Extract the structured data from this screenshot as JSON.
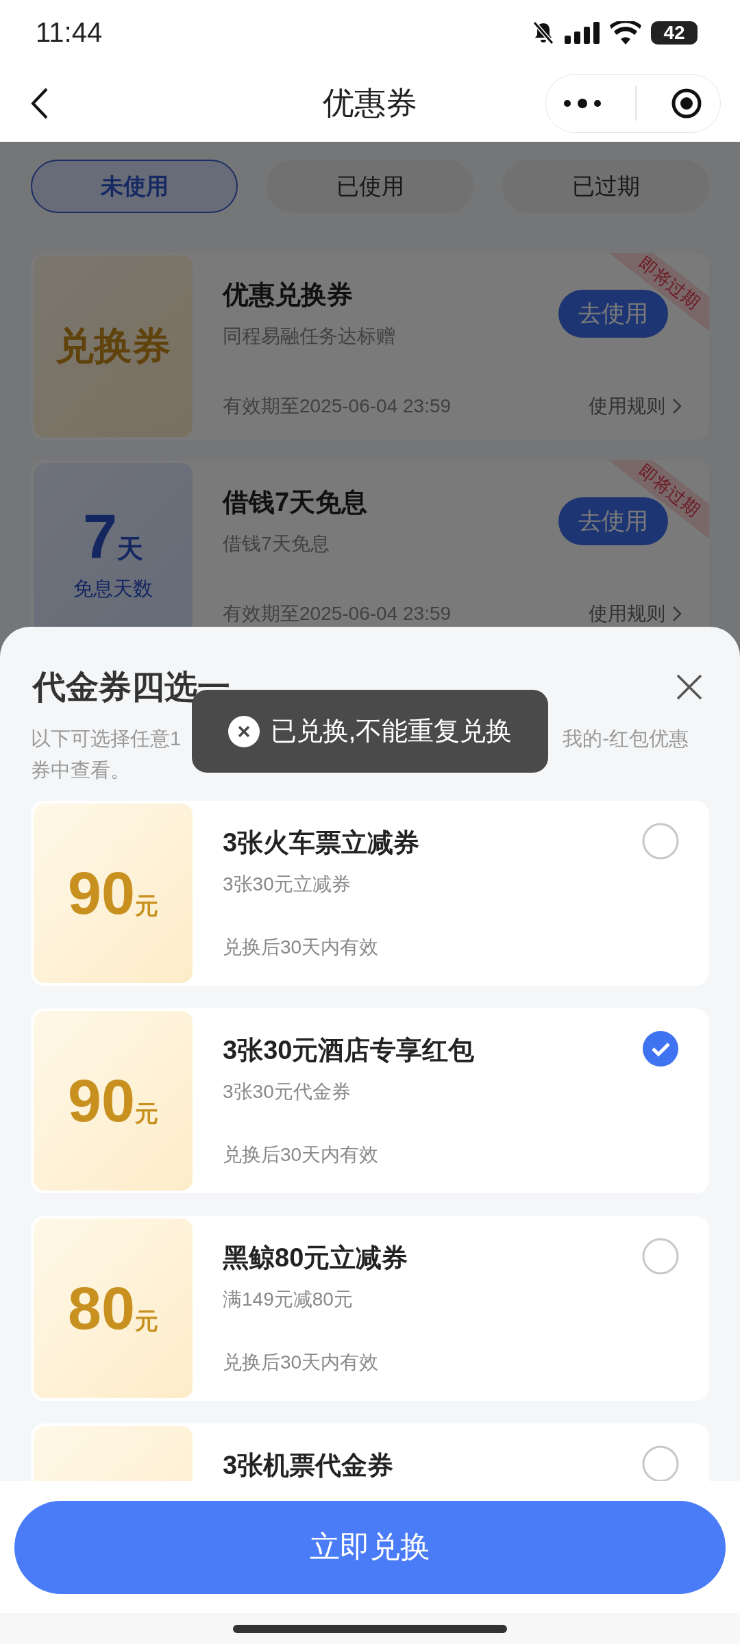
{
  "status_bar": {
    "time": "11:44",
    "battery": "42"
  },
  "nav": {
    "title": "优惠券"
  },
  "tabs": [
    {
      "label": "未使用",
      "selected": true
    },
    {
      "label": "已使用",
      "selected": false
    },
    {
      "label": "已过期",
      "selected": false
    }
  ],
  "coupons": [
    {
      "left": {
        "kind": "label",
        "text": "兑换券"
      },
      "title": "优惠兑换券",
      "subtitle": "同程易融任务达标赠",
      "validity": "有效期至2025-06-04 23:59",
      "action": "去使用",
      "rules": "使用规则",
      "ribbon": "即将过期"
    },
    {
      "left": {
        "kind": "days",
        "value": "7",
        "unit": "天",
        "caption": "免息天数"
      },
      "title": "借钱7天免息",
      "subtitle": "借钱7天免息",
      "validity": "有效期至2025-06-04 23:59",
      "action": "去使用",
      "rules": "使用规则",
      "ribbon": "即将过期"
    }
  ],
  "sheet": {
    "title": "代金券四选一",
    "description": [
      [
        "以下可选择任意1",
        "我的-红包优惠"
      ],
      [
        "券中查看。"
      ]
    ],
    "options": [
      {
        "amount": "90",
        "unit": "元",
        "title": "3张火车票立减券",
        "subtitle": "3张30元立减券",
        "validity": "兑换后30天内有效",
        "selected": false
      },
      {
        "amount": "90",
        "unit": "元",
        "title": "3张30元酒店专享红包",
        "subtitle": "3张30元代金券",
        "validity": "兑换后30天内有效",
        "selected": true
      },
      {
        "amount": "80",
        "unit": "元",
        "title": "黑鲸80元立减券",
        "subtitle": "满149元减80元",
        "validity": "兑换后30天内有效",
        "selected": false
      },
      {
        "title": "3张机票代金券",
        "selected": false
      }
    ],
    "confirm_button": "立即兑换"
  },
  "toast": {
    "text": "已兑换,不能重复兑换"
  }
}
